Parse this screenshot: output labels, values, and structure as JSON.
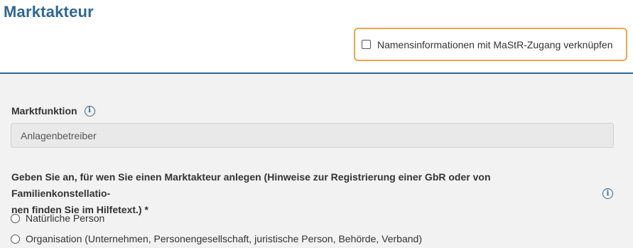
{
  "page": {
    "title": "Marktakteur"
  },
  "link_option": {
    "label": "Namensinformationen mit MaStR-Zugang verknüpfen",
    "checked": false
  },
  "marktfunktion": {
    "label": "Marktfunktion",
    "value": "Anlagenbetreiber"
  },
  "akteur_type": {
    "question_line1": "Geben Sie an, für wen Sie einen Marktakteur anlegen (Hinweise zur Registrierung einer GbR oder von Familienkonstellatio-",
    "question_line2": "nen finden Sie im Hilfetext.) *",
    "options": [
      {
        "label": "Natürliche Person",
        "selected": false
      },
      {
        "label": "Organisation (Unternehmen, Personengesellschaft, juristische Person, Behörde, Verband)",
        "selected": false
      }
    ]
  },
  "icons": {
    "info": "info-icon"
  },
  "colors": {
    "title": "#2f6694",
    "highlight_border": "#f2a54a",
    "panel_bg": "#f2f2f2"
  }
}
